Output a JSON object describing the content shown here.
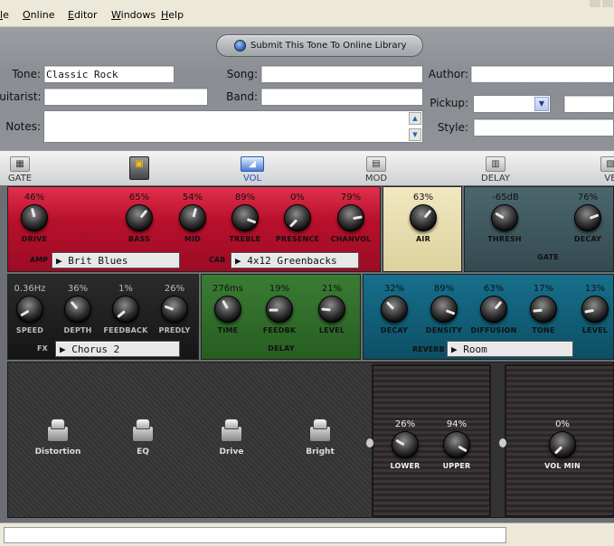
{
  "menu": {
    "file": "le",
    "online": "Online",
    "editor": "Editor",
    "windows": "Windows",
    "help": "Help"
  },
  "header": {
    "submit_label": "Submit This Tone To Online Library",
    "tone_label": "Tone:",
    "tone_value": "Classic Rock",
    "song_label": "Song:",
    "song_value": "",
    "author_label": "Author:",
    "author_value": "",
    "guitarist_label": "Guitarist:",
    "guitarist_value": "",
    "band_label": "Band:",
    "band_value": "",
    "pickup_label": "Pickup:",
    "pickup_value": "",
    "notes_label": "Notes:",
    "notes_value": "",
    "style_label": "Style:",
    "style_value": ""
  },
  "tabs": {
    "gate": "GATE",
    "vol": "VOL",
    "mod": "MOD",
    "delay": "DELAY",
    "verb": "VE"
  },
  "amp": {
    "knobs": [
      {
        "value": "46%",
        "label": "DRIVE"
      },
      {
        "value": "65%",
        "label": "BASS"
      },
      {
        "value": "54%",
        "label": "MID"
      },
      {
        "value": "89%",
        "label": "TREBLE"
      },
      {
        "value": "0%",
        "label": "PRESENCE"
      },
      {
        "value": "79%",
        "label": "CHANVOL"
      }
    ],
    "amp_label": "AMP",
    "amp_model": "Brit Blues",
    "cab_label": "CAB",
    "cab_model": "4x12 Greenbacks"
  },
  "air": {
    "value": "63%",
    "label": "AIR"
  },
  "gate": {
    "thresh_value": "-65dB",
    "thresh_label": "THRESH",
    "decay_value": "76%",
    "decay_label": "DECAY",
    "title": "GATE"
  },
  "fx": {
    "knobs": [
      {
        "value": "0.36Hz",
        "label": "SPEED"
      },
      {
        "value": "36%",
        "label": "DEPTH"
      },
      {
        "value": "1%",
        "label": "FEEDBACK"
      },
      {
        "value": "26%",
        "label": "PREDLY"
      }
    ],
    "fx_label": "FX",
    "model": "Chorus 2"
  },
  "delay": {
    "knobs": [
      {
        "value": "276ms",
        "label": "TIME"
      },
      {
        "value": "19%",
        "label": "FEEDBK"
      },
      {
        "value": "21%",
        "label": "LEVEL"
      }
    ],
    "title": "DELAY"
  },
  "reverb": {
    "knobs": [
      {
        "value": "32%",
        "label": "DECAY"
      },
      {
        "value": "89%",
        "label": "DENSITY"
      },
      {
        "value": "63%",
        "label": "DIFFUSION"
      },
      {
        "value": "17%",
        "label": "TONE"
      },
      {
        "value": "13%",
        "label": "LEVEL"
      }
    ],
    "reverb_label": "REVERB",
    "model": "Room"
  },
  "footswitches": [
    "Distortion",
    "EQ",
    "Drive",
    "Bright"
  ],
  "wah": {
    "lower_value": "26%",
    "lower_label": "LOWER",
    "upper_value": "94%",
    "upper_label": "UPPER"
  },
  "volume": {
    "min_value": "0%",
    "min_label": "VOL MIN"
  },
  "colors": {
    "amp": "#b8102c",
    "air": "#e7dcac",
    "gate": "#3c5359",
    "fx": "#1e1e1e",
    "delay": "#2f6b2a",
    "reverb": "#0e5a73"
  }
}
